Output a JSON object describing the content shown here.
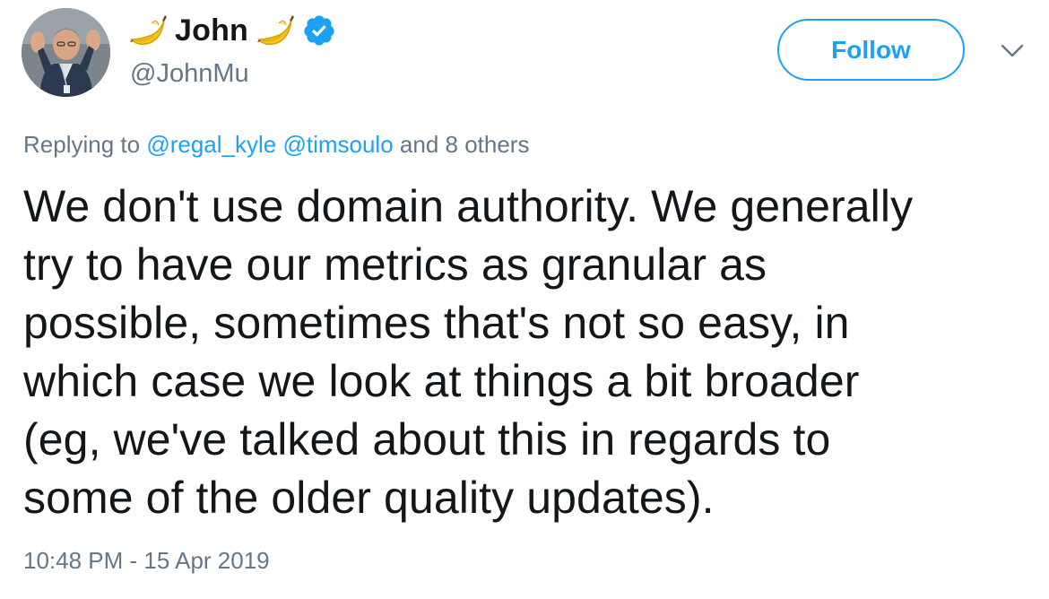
{
  "author": {
    "display_name": "John",
    "handle": "@JohnMu",
    "verified": true,
    "name_emoji_left": "banana-emoji",
    "name_emoji_right": "banana-emoji",
    "avatar": "profile-photo"
  },
  "actions": {
    "follow_label": "Follow",
    "menu_icon": "chevron-down-icon"
  },
  "reply": {
    "prefix": "Replying to",
    "mentions": [
      "@regal_kyle",
      "@timsoulo"
    ],
    "others": "and 8 others"
  },
  "tweet": {
    "text": "We don't use domain authority. We generally\ntry to have our metrics as granular as\npossible, sometimes that's not so easy, in\nwhich case we look at things a bit broader\n(eg, we've talked about this in regards to\nsome of the older quality updates).",
    "timestamp": "10:48 PM - 15 Apr 2019"
  },
  "colors": {
    "accent": "#1da1f2",
    "text_primary": "#14171a",
    "text_secondary": "#657786"
  }
}
